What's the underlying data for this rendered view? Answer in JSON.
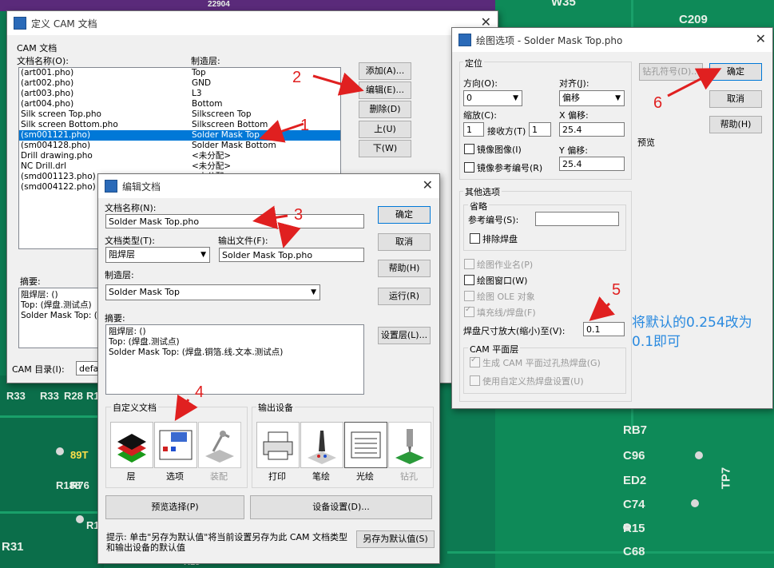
{
  "pcb": {
    "labels": [
      "C209",
      "W35",
      "R33",
      "R33",
      "R28",
      "R14",
      "89T",
      "R188",
      "R76",
      "R15",
      "R31",
      "RB7",
      "C96",
      "ED2",
      "C74",
      "R15",
      "C68",
      "TP7",
      "22904",
      "R18"
    ]
  },
  "cam_dialog": {
    "title": "定义 CAM 文档",
    "group_label": "CAM 文档",
    "col_name": "文档名称(O):",
    "col_layer": "制造层:",
    "rows": [
      {
        "name": "(art001.pho)",
        "layer": "Top"
      },
      {
        "name": "(art002.pho)",
        "layer": "GND"
      },
      {
        "name": "(art003.pho)",
        "layer": "L3"
      },
      {
        "name": "(art004.pho)",
        "layer": "Bottom"
      },
      {
        "name": "Silk screen Top.pho",
        "layer": "Silkscreen Top"
      },
      {
        "name": "Silk screen Bottom.pho",
        "layer": "Silkscreen Bottom"
      },
      {
        "name": "(sm001121.pho)",
        "layer": "Solder Mask Top"
      },
      {
        "name": "(sm004128.pho)",
        "layer": "Solder Mask Bottom"
      },
      {
        "name": "Drill drawing.pho",
        "layer": "<未分配>"
      },
      {
        "name": "NC Drill.drl",
        "layer": "<未分配>"
      },
      {
        "name": "(smd001123.pho)",
        "layer": "<未分配>"
      },
      {
        "name": "(smd004122.pho)",
        "layer": ""
      }
    ],
    "btn_add": "添加(A)...",
    "btn_edit": "编辑(E)...",
    "btn_delete": "删除(D)",
    "btn_up": "上(U)",
    "btn_down": "下(W)",
    "summary_label": "摘要:",
    "summary_lines": [
      "阻焊层: ()",
      "Top: (焊盘.测试点)",
      "Solder Mask Top: (焊"
    ],
    "dir_label": "CAM 目录(I):",
    "dir_value": "defau"
  },
  "edit_dialog": {
    "title": "编辑文档",
    "name_label": "文档名称(N):",
    "name_value": "Solder Mask Top.pho",
    "type_label": "文档类型(T):",
    "type_value": "阻焊层",
    "output_label": "输出文件(F):",
    "output_value": "Solder Mask Top.pho",
    "layer_label": "制造层:",
    "layer_value": "Solder Mask Top",
    "summary_label": "摘要:",
    "summary_lines": [
      "阻焊层: ()",
      "Top: (焊盘.测试点)",
      "Solder Mask Top: (焊盘.铜箔.线.文本.测试点)"
    ],
    "btn_ok": "确定",
    "btn_cancel": "取消",
    "btn_help": "帮助(H)",
    "btn_run": "运行(R)",
    "btn_setlayer": "设置层(L)...",
    "custom_label": "自定义文档",
    "custom_tools": [
      "层",
      "选项",
      "装配"
    ],
    "output_label2": "输出设备",
    "output_tools": [
      "打印",
      "笔绘",
      "光绘",
      "钻孔"
    ],
    "btn_preview": "预览选择(P)",
    "btn_device": "设备设置(D)...",
    "hint": "提示: 单击\"另存为默认值\"将当前设置另存为此 CAM 文档类型和输出设备的默认值",
    "btn_savedefault": "另存为默认值(S)"
  },
  "plot_dialog": {
    "title": "绘图选项 - Solder Mask Top.pho",
    "pos_group": "定位",
    "orient_label": "方向(O):",
    "orient_value": "0",
    "align_label": "对齐(J):",
    "align_value": "偏移",
    "scale_label": "缩放(C):",
    "scale_value": "1",
    "fit_label": "接收方(T)",
    "fit_value": "1",
    "xoff_label": "X 偏移:",
    "xoff_value": "25.4",
    "yoff_label": "Y 偏移:",
    "yoff_value": "25.4",
    "mirror_label": "镜像图像(I)",
    "mirror_ref_label": "镜像参考编号(R)",
    "btn_drill": "钻孔符号(D)...",
    "btn_ok": "确定",
    "btn_cancel": "取消",
    "btn_help": "帮助(H)",
    "preview_label": "预览",
    "other_group": "其他选项",
    "omit_group": "省略",
    "refdes_label": "参考编号(S):",
    "exclude_pads": "排除焊盘",
    "plot_job": "绘图作业名(P)",
    "plot_window": "绘图窗口(W)",
    "plot_ole": "绘图 OLE 对象",
    "fill_pads": "填充线/焊盘(F)",
    "pad_scale_label": "焊盘尺寸放大(缩小)至(V):",
    "pad_scale_value": "0.1",
    "cam_group": "CAM 平面层",
    "gen_thermal": "生成 CAM 平面过孔热焊盘(G)",
    "custom_thermal": "使用自定义热焊盘设置(U)"
  },
  "annotations": {
    "marks": [
      "1",
      "2",
      "3",
      "4",
      "5",
      "6"
    ],
    "note": "将默认的0.254改为0.1即可"
  },
  "colors": {
    "pcb": "#0d7a52",
    "select": "#0078d7",
    "red": "#e02020",
    "note": "#2a8adf"
  }
}
